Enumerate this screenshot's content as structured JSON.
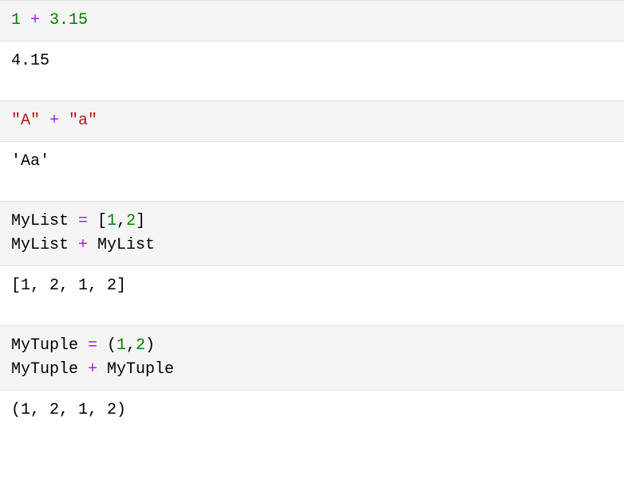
{
  "cells": [
    {
      "input_tokens": {
        "n1": "1",
        "op1": " + ",
        "n2": "3.15"
      },
      "output": "4.15"
    },
    {
      "input_tokens": {
        "s1": "\"A\"",
        "op1": " + ",
        "s2": "\"a\""
      },
      "output": "'Aa'"
    },
    {
      "input_tokens": {
        "id1": "MyList ",
        "op1": "=",
        "sp1": " [",
        "n1": "1",
        "c1": ",",
        "n2": "2",
        "rb1": "]",
        "nl": "\n",
        "id2": "MyList ",
        "op2": "+",
        "sp2": " MyList"
      },
      "output": "[1, 2, 1, 2]"
    },
    {
      "input_tokens": {
        "id1": "MyTuple ",
        "op1": "=",
        "sp1": " (",
        "n1": "1",
        "c1": ",",
        "n2": "2",
        "rb1": ")",
        "nl": "\n",
        "id2": "MyTuple ",
        "op2": "+",
        "sp2": " MyTuple"
      },
      "output": "(1, 2, 1, 2)"
    }
  ]
}
